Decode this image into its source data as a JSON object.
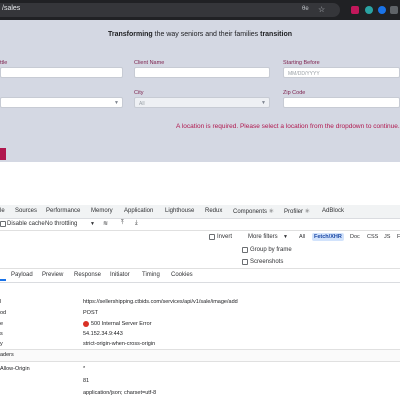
{
  "browser": {
    "url_fragment": "/sales",
    "ext_label": "Ba"
  },
  "page": {
    "tagline_bold1": "Transforming",
    "tagline_mid": " the way seniors and their families ",
    "tagline_bold2": "transition",
    "fields": {
      "title_label": "ttle",
      "client_name_label": "Client Name",
      "starting_before_label": "Starting Before",
      "starting_before_placeholder": "MM/DD/YYYY",
      "city_label": "City",
      "city_value": "All",
      "zip_label": "Zip Code"
    },
    "error": "A location is required. Please select a location from the dropdown to continue."
  },
  "devtools": {
    "tabs": [
      "le",
      "Sources",
      "Performance",
      "Memory",
      "Application",
      "Lighthouse",
      "Redux",
      "Components ⚛",
      "Profiler ⚛",
      "AdBlock"
    ],
    "disable_cache": "Disable cache",
    "throttling": "No throttling",
    "invert": "Invert",
    "more_filters": "More filters",
    "filters": [
      "All",
      "Fetch/XHR",
      "Doc",
      "CSS",
      "JS",
      "F"
    ],
    "group_by_frame": "Group by frame",
    "screenshots": "Screenshots",
    "subtabs": [
      "Payload",
      "Preview",
      "Response",
      "Initiator",
      "Timing",
      "Cookies"
    ],
    "general": {
      "request_url": "https://sellershipping.ctbids.com/services/api/v1/sale/image/add",
      "method": "POST",
      "status": "500 Internal Server Error",
      "remote_address": "54.152.34.9:443",
      "referrer_policy": "strict-origin-when-cross-origin"
    },
    "labels": {
      "url_l": "l",
      "method_l": "od",
      "status_l": "e",
      "remote_l": "s",
      "policy_l": "y"
    },
    "section_title": "aders",
    "headers": {
      "allow_origin_label": "Allow-Origin",
      "allow_origin_value": "*",
      "length_value": "81",
      "content_type_value": "application/json; charset=utf-8"
    }
  }
}
